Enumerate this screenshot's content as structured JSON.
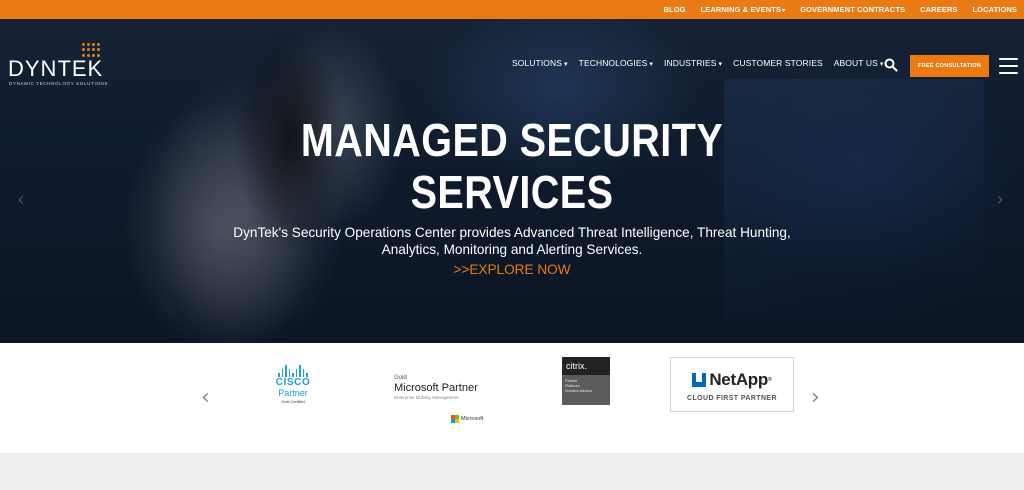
{
  "topbar": {
    "links": [
      {
        "label": "BLOG",
        "dropdown": false
      },
      {
        "label": "LEARNING & EVENTS",
        "dropdown": true
      },
      {
        "label": "GOVERNMENT CONTRACTS",
        "dropdown": false
      },
      {
        "label": "CAREERS",
        "dropdown": false
      },
      {
        "label": "LOCATIONS",
        "dropdown": false
      }
    ],
    "caret": "▾",
    "color": "#ea7a13"
  },
  "brand": {
    "name": "DYNTEK",
    "tagline": "DYNAMIC TECHNOLOGY SOLUTIONS",
    "accent": "#ea7a13"
  },
  "nav": {
    "items": [
      {
        "label": "SOLUTIONS",
        "dropdown": true
      },
      {
        "label": "TECHNOLOGIES",
        "dropdown": true
      },
      {
        "label": "INDUSTRIES",
        "dropdown": true
      },
      {
        "label": "CUSTOMER STORIES",
        "dropdown": false
      },
      {
        "label": "ABOUT US",
        "dropdown": true
      }
    ],
    "search_icon": "search-icon",
    "cta_label": "FREE CONSULTATION",
    "menu_icon": "hamburger-icon"
  },
  "hero": {
    "headline_line1": "MANAGED SECURITY",
    "headline_line2": "SERVICES",
    "subtext_line1": "DynTek's Security Operations Center provides Advanced Threat Intelligence, Threat Hunting,",
    "subtext_line2": "Analytics, Monitoring and Alerting Services.",
    "link_label": ">>EXPLORE NOW",
    "slide_indicator_color": "#2aa6c4"
  },
  "partners": {
    "prev_icon": "chevron-left-icon",
    "next_icon": "chevron-right-icon",
    "cisco": {
      "word": "CISCO",
      "partner": "Partner",
      "level": "Gold Certified",
      "color": "#1ba0d7"
    },
    "microsoft": {
      "level": "Gold",
      "title": "Microsoft Partner",
      "competency": "Enterprise Mobility Management",
      "brand": "Microsoft"
    },
    "citrix": {
      "name": "citrix.",
      "line1": "Partner",
      "line2": "Platinum",
      "line3": "Solution Advisor"
    },
    "netapp": {
      "name": "NetApp",
      "reg": "®",
      "badge": "CLOUD FIRST PARTNER",
      "color": "#0067c5"
    }
  }
}
